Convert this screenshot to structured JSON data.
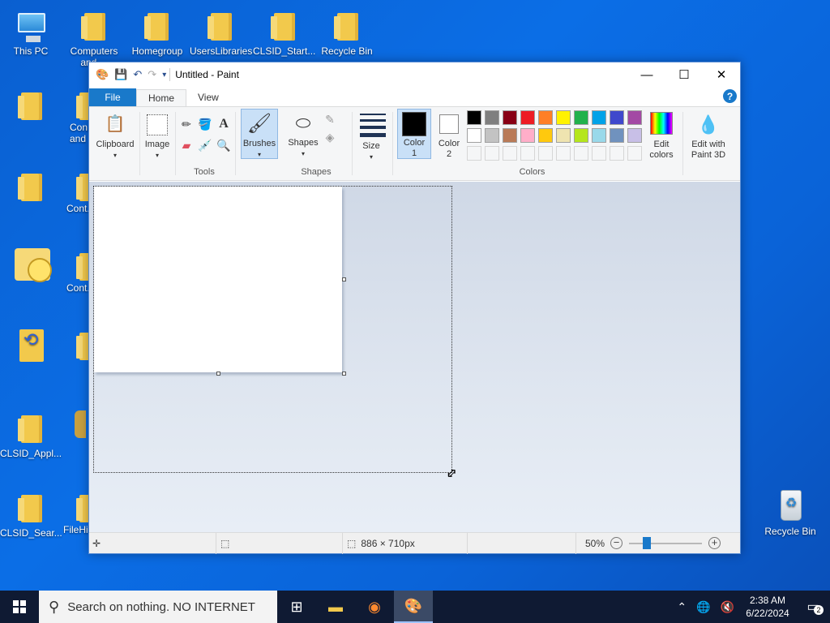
{
  "desktop": {
    "icons": [
      {
        "label": "This PC"
      },
      {
        "label": "Computers and ..."
      },
      {
        "label": "Homegroup"
      },
      {
        "label": "UsersLibraries"
      },
      {
        "label": "CLSID_Start..."
      },
      {
        "label": "Recycle Bin"
      },
      {
        "label": "Con... and"
      },
      {
        "label": "Cont..."
      },
      {
        "label": "Cont..."
      },
      {
        "label": "CLSID_Appl..."
      },
      {
        "label": "CLSID_Sear..."
      },
      {
        "label": "FileHi..."
      },
      {
        "label": "Recycle Bin"
      }
    ]
  },
  "paint": {
    "title": "Untitled - Paint",
    "tabs": {
      "file": "File",
      "home": "Home",
      "view": "View"
    },
    "help": "?",
    "ribbon": {
      "clipboard": "Clipboard",
      "image": "Image",
      "tools_label": "Tools",
      "brushes": "Brushes",
      "shapes": "Shapes",
      "shapes_label": "Shapes",
      "size": "Size",
      "color1": "Color 1",
      "color2": "Color 2",
      "colors_label": "Colors",
      "edit_colors": "Edit colors",
      "edit_paint3d": "Edit with Paint 3D"
    },
    "palette_row1": [
      "#000000",
      "#7f7f7f",
      "#880015",
      "#ed1c24",
      "#ff7f27",
      "#fff200",
      "#22b14c",
      "#00a2e8",
      "#3f48cc",
      "#a349a4"
    ],
    "palette_row2": [
      "#ffffff",
      "#c3c3c3",
      "#b97a57",
      "#ffaec9",
      "#ffc90e",
      "#efe4b0",
      "#b5e61d",
      "#99d9ea",
      "#7092be",
      "#c8bfe7"
    ],
    "color1_value": "#000000",
    "color2_value": "#ffffff",
    "status": {
      "dimensions": "886 × 710px",
      "zoom": "50%"
    }
  },
  "taskbar": {
    "search_placeholder": "Search on nothing. NO INTERNET",
    "time": "2:38 AM",
    "date": "6/22/2024",
    "notifications": "2"
  }
}
